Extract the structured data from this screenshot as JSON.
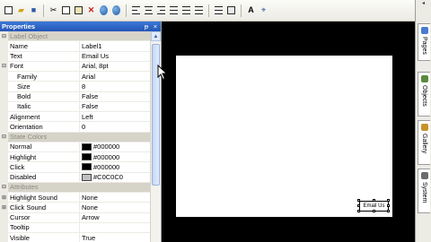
{
  "toolbar": {
    "icons": [
      "new-icon",
      "open-icon",
      "save-icon",
      "cut-icon",
      "copy-icon",
      "paste-icon",
      "delete-icon",
      "preview-icon",
      "run-icon",
      "align-left-icon",
      "align-center-icon",
      "align-right-icon",
      "align-top-icon",
      "align-middle-icon",
      "align-bottom-icon",
      "distribute-icon",
      "grid-icon",
      "text-color-icon",
      "font-icon"
    ]
  },
  "panel": {
    "title": "Properties",
    "pin": "ᵽ",
    "close": "×",
    "rows": [
      {
        "type": "cat",
        "name": "Label Object"
      },
      {
        "type": "prop",
        "name": "Name",
        "value": "Label1"
      },
      {
        "type": "prop",
        "name": "Text",
        "value": "Email Us"
      },
      {
        "type": "prop",
        "name": "Font",
        "value": "Arial, 8pt",
        "expand": "⊟"
      },
      {
        "type": "prop",
        "name": "Family",
        "value": "Arial",
        "indent": true
      },
      {
        "type": "prop",
        "name": "Size",
        "value": "8",
        "indent": true
      },
      {
        "type": "prop",
        "name": "Bold",
        "value": "False",
        "indent": true
      },
      {
        "type": "prop",
        "name": "Italic",
        "value": "False",
        "indent": true
      },
      {
        "type": "prop",
        "name": "Alignment",
        "value": "Left"
      },
      {
        "type": "prop",
        "name": "Orientation",
        "value": "0"
      },
      {
        "type": "cat",
        "name": "State Colors"
      },
      {
        "type": "prop",
        "name": "Normal",
        "value": "#000000",
        "swatch": "#000000"
      },
      {
        "type": "prop",
        "name": "Highlight",
        "value": "#000000",
        "swatch": "#000000"
      },
      {
        "type": "prop",
        "name": "Click",
        "value": "#000000",
        "swatch": "#000000"
      },
      {
        "type": "prop",
        "name": "Disabled",
        "value": "#C0C0C0",
        "swatch": "#C0C0C0"
      },
      {
        "type": "cat",
        "name": "Attributes"
      },
      {
        "type": "prop",
        "name": "Highlight Sound",
        "value": "None",
        "expand": "⊞"
      },
      {
        "type": "prop",
        "name": "Click Sound",
        "value": "None",
        "expand": "⊞"
      },
      {
        "type": "prop",
        "name": "Cursor",
        "value": "Arrow"
      },
      {
        "type": "prop",
        "name": "Tooltip",
        "value": ""
      },
      {
        "type": "prop",
        "name": "Visible",
        "value": "True"
      }
    ]
  },
  "canvas": {
    "label_text": "Email Us"
  },
  "sidetabs": [
    {
      "label": "Pages",
      "icon_color": "#4a7bd0"
    },
    {
      "label": "Objects",
      "icon_color": "#5a8a3c"
    },
    {
      "label": "Gallery",
      "icon_color": "#c9922a"
    },
    {
      "label": "System",
      "icon_color": "#6b6b6b"
    }
  ]
}
